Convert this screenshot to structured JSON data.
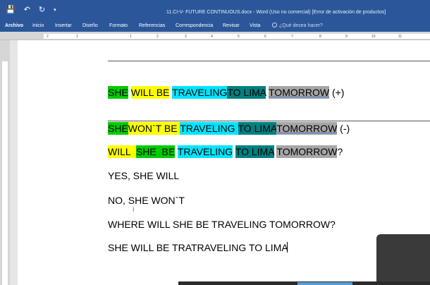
{
  "window": {
    "title": "11.CI-V- FUTURE CONTINUOUS.docx - Word (Uso no comercial) [Error de activación de productos]"
  },
  "qat": {
    "save_icon": "save-icon",
    "undo_icon": "undo-icon",
    "redo_icon": "redo-icon",
    "customize_icon": "customize-icon"
  },
  "tabs": [
    "Archivo",
    "Inicio",
    "Insertar",
    "Diseño",
    "Formato",
    "Referencias",
    "Correspondencia",
    "Revisar",
    "Vista"
  ],
  "tell_me": "¿Qué desea hacer?",
  "ruler": [
    "2",
    "1",
    "1",
    "2",
    "3",
    "4",
    "5",
    "6",
    "7",
    "8",
    "9",
    "10",
    "11"
  ],
  "document": {
    "line1": [
      "SHE",
      "WILL BE",
      "TRAVELING",
      "TO LIMA",
      "TOMORROW",
      " (+)"
    ],
    "line2": [
      "SHE",
      "WON`T BE ",
      "TRAVELING",
      "TO LIMA",
      "TOMORROW",
      " (-)"
    ],
    "line3": [
      "WILL  ",
      "SHE  BE",
      "TRAVELING",
      "TO LIMA",
      "TOMORROW",
      "?"
    ],
    "line4": "YES, SHE WILL",
    "line5": "NO, SHE WON`T",
    "line6": "WHERE WILL SHE BE TRAVELING TOMORROW?",
    "line7": "SHE WILL BE TRATRAVELING TO LIMA"
  },
  "colors": {
    "green": "#00cc00",
    "yellow": "#ffff00",
    "cyan": "#00e5ff",
    "teal": "#008080",
    "gray": "#a6a6a6",
    "titlebar": "#2b579a"
  }
}
